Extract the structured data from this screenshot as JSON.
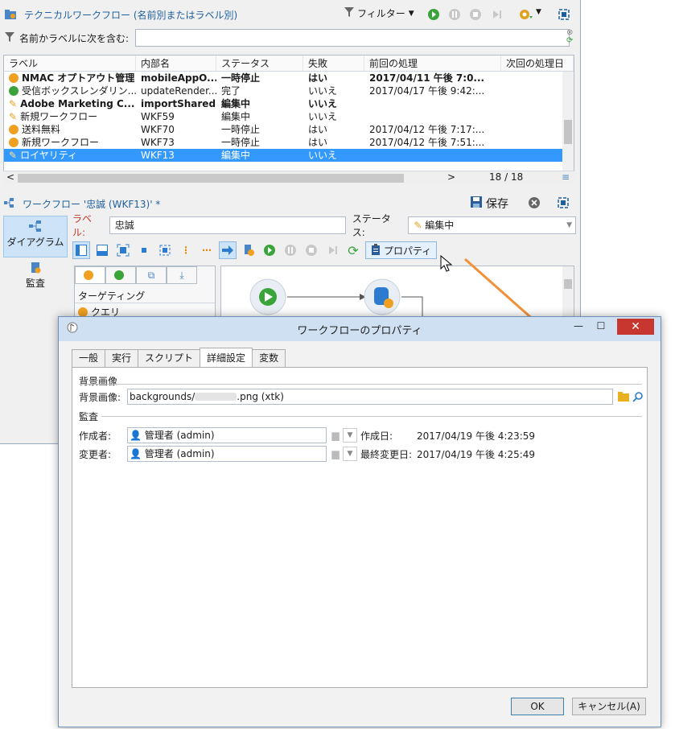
{
  "main": {
    "title": "テクニカルワークフロー (名前別またはラベル別)",
    "filter_label": "フィルター",
    "search_label": "名前かラベルに次を含む:",
    "search_value": ""
  },
  "list": {
    "headers": [
      "ラベル",
      "内部名",
      "ステータス",
      "失敗",
      "前回の処理",
      "次回の処理日"
    ],
    "rows": [
      {
        "label": "NMAC オプトアウト管理",
        "name": "mobileAppO...",
        "status": "一時停止",
        "fail": "はい",
        "last": "2017/04/11 午後 7:0...",
        "icon": "pause",
        "bold": true
      },
      {
        "label": "受信ボックスレンダリン...",
        "name": "updateRender...",
        "status": "完了",
        "fail": "いいえ",
        "last": "2017/04/17 午後 9:42:...",
        "icon": "check",
        "bold": false
      },
      {
        "label": "Adobe Marketing C...",
        "name": "importShared",
        "status": "編集中",
        "fail": "いいえ",
        "last": "",
        "icon": "pencil",
        "bold": true
      },
      {
        "label": "新規ワークフロー",
        "name": "WKF59",
        "status": "編集中",
        "fail": "いいえ",
        "last": "",
        "icon": "pencil",
        "bold": false
      },
      {
        "label": "送料無料",
        "name": "WKF70",
        "status": "一時停止",
        "fail": "はい",
        "last": "2017/04/12 午後 7:17:...",
        "icon": "pause",
        "bold": false
      },
      {
        "label": "新規ワークフロー",
        "name": "WKF73",
        "status": "一時停止",
        "fail": "はい",
        "last": "2017/04/12 午後 7:51:...",
        "icon": "pause",
        "bold": false
      },
      {
        "label": "ロイヤリティ",
        "name": "WKF13",
        "status": "編集中",
        "fail": "いいえ",
        "last": "",
        "icon": "pencil",
        "bold": false,
        "selected": true
      }
    ],
    "pager": "18 / 18"
  },
  "workflow": {
    "title": "ワークフロー '忠誠 (WKF13)' *",
    "save_label": "保存",
    "nav_diagram": "ダイアグラム",
    "nav_audit": "監査",
    "label_caption": "ラベル:",
    "label_value": "忠誠",
    "status_caption": "ステータス:",
    "status_value": "編集中",
    "properties_label": "プロパティ",
    "palette_item_targeting": "ターゲティング",
    "palette_item_query": "クエリ"
  },
  "dialog": {
    "title": "ワークフローのプロパティ",
    "tabs": [
      "一般",
      "実行",
      "スクリプト",
      "詳細設定",
      "変数"
    ],
    "section_bg": "背景画像",
    "bg_label": "背景画像:",
    "bg_value_prefix": "backgrounds/",
    "bg_value_suffix": ".png (xtk)",
    "section_audit": "監査",
    "creator_label": "作成者:",
    "creator_value": "管理者 (admin)",
    "created_label": "作成日:",
    "created_value": "2017/04/19 午後 4:23:59",
    "modifier_label": "変更者:",
    "modifier_value": "管理者 (admin)",
    "modified_label": "最終変更日:",
    "modified_value": "2017/04/19 午後 4:25:49",
    "ok_label": "OK",
    "cancel_label": "キャンセル(A)"
  },
  "colors": {
    "accent": "#1f5f9e",
    "selection": "#3399ff",
    "pause": "#f0a020",
    "check": "#3aa33a",
    "arrow": "#f0913a"
  }
}
